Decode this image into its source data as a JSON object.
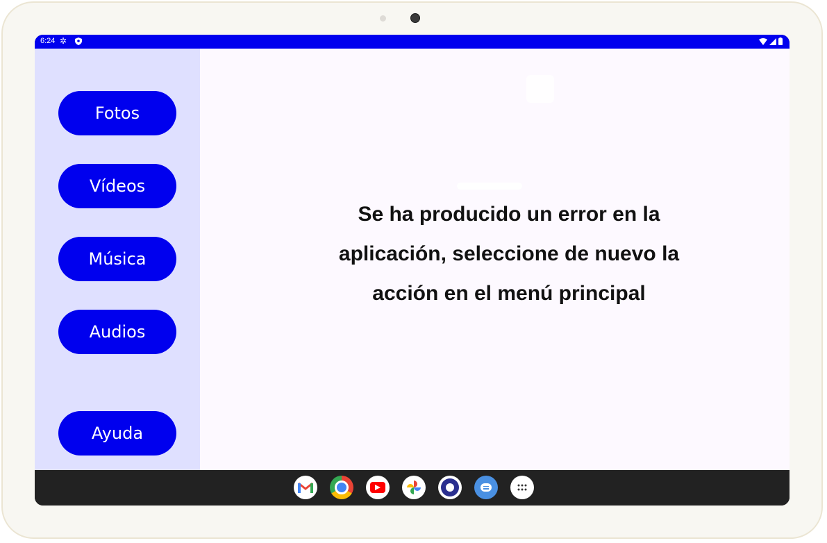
{
  "statusbar": {
    "time": "6:24",
    "left_icons": [
      "gear-icon",
      "shield-icon"
    ],
    "right_icons": [
      "wifi-icon",
      "signal-icon",
      "battery-icon"
    ]
  },
  "sidebar": {
    "buttons": [
      {
        "label": "Fotos"
      },
      {
        "label": "Vídeos"
      },
      {
        "label": "Música"
      },
      {
        "label": "Audios"
      },
      {
        "label": "Ayuda"
      }
    ]
  },
  "content": {
    "error_line1": "Se ha producido un error en la",
    "error_line2": "aplicación, seleccione de nuevo la",
    "error_line3": "acción en el menú principal"
  },
  "taskbar": {
    "apps": [
      "gmail-icon",
      "chrome-icon",
      "youtube-icon",
      "photos-icon",
      "assistant-app-icon",
      "messages-icon",
      "app-drawer-icon"
    ]
  },
  "colors": {
    "accent": "#0000ee",
    "sidebar_bg": "#dfe0ff",
    "content_bg": "#fdf9ff",
    "taskbar_bg": "#222222"
  }
}
